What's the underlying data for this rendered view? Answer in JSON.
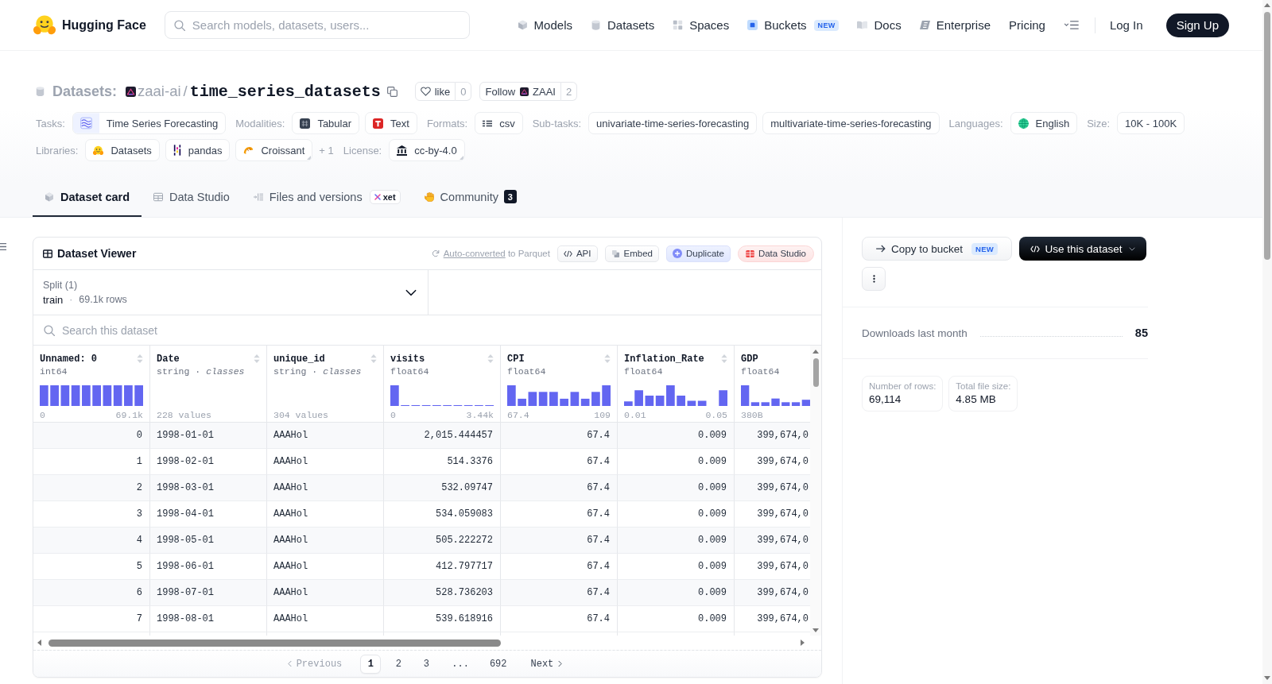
{
  "header": {
    "logo": "Hugging Face",
    "search": {
      "placeholder": "Search models, datasets, users..."
    },
    "nav": [
      {
        "label": "Models"
      },
      {
        "label": "Datasets"
      },
      {
        "label": "Spaces"
      },
      {
        "label": "Buckets",
        "badge": "NEW"
      },
      {
        "label": "Docs"
      },
      {
        "label": "Enterprise"
      },
      {
        "label": "Pricing"
      }
    ],
    "login": "Log In",
    "signup": "Sign Up"
  },
  "repo": {
    "type": "Datasets:",
    "owner": "zaai-ai",
    "separator": "/",
    "name": "time_series_datasets",
    "like": {
      "label": "like",
      "count": "0"
    },
    "follow": {
      "label": "Follow",
      "org": "ZAAI",
      "count": "2"
    }
  },
  "tag_rows": [
    {
      "groups": [
        {
          "label": "Tasks:",
          "tags": [
            {
              "text": "Time Series Forecasting"
            }
          ]
        },
        {
          "label": "Modalities:",
          "tags": [
            {
              "text": "Tabular"
            },
            {
              "text": "Text"
            }
          ]
        },
        {
          "label": "Formats:",
          "tags": [
            {
              "text": "csv"
            }
          ]
        },
        {
          "label": "Sub-tasks:",
          "tags": [
            {
              "text": "univariate-time-series-forecasting"
            },
            {
              "text": "multivariate-time-series-forecasting"
            }
          ]
        },
        {
          "label": "Languages:",
          "tags": [
            {
              "text": "English"
            }
          ]
        },
        {
          "label": "Size:",
          "tags": [
            {
              "text": "10K - 100K"
            }
          ]
        }
      ]
    },
    {
      "groups": [
        {
          "label": "Libraries:",
          "tags": [
            {
              "text": "Datasets",
              "dropdown": false
            },
            {
              "text": "pandas",
              "dropdown": false
            },
            {
              "text": "Croissant",
              "dropdown": true
            }
          ],
          "more": "+ 1"
        },
        {
          "label": "License:",
          "tags": [
            {
              "text": "cc-by-4.0",
              "dropdown": true
            }
          ]
        }
      ]
    }
  ],
  "tabs": [
    {
      "label": "Dataset card",
      "selected": true
    },
    {
      "label": "Data Studio",
      "selected": false
    },
    {
      "label": "Files and versions",
      "selected": false,
      "badge": "xet"
    },
    {
      "label": "Community",
      "selected": false,
      "count": "3"
    }
  ],
  "viewer": {
    "title": "Dataset Viewer",
    "conversion": {
      "link": "Auto-converted",
      "text": "to Parquet"
    },
    "actions": [
      {
        "label": "API"
      },
      {
        "label": "Embed"
      },
      {
        "label": "Duplicate"
      },
      {
        "label": "Data Studio"
      }
    ],
    "split": {
      "label": "Split (1)",
      "value": "train",
      "separator": "·",
      "rows": "69.1k rows"
    },
    "search": {
      "placeholder": "Search this dataset"
    },
    "columns": [
      {
        "name": "Unnamed: 0",
        "type": "int64",
        "kind": "numeric",
        "min": "0",
        "max": "69.1k"
      },
      {
        "name": "Date",
        "type": "string · *classes*",
        "kind": "classes",
        "count": "228 values"
      },
      {
        "name": "unique_id",
        "type": "string · *classes*",
        "kind": "classes",
        "count": "304 values"
      },
      {
        "name": "visits",
        "type": "float64",
        "kind": "numeric",
        "min": "0",
        "max": "3.44k"
      },
      {
        "name": "CPI",
        "type": "float64",
        "kind": "numeric",
        "min": "67.4",
        "max": "109"
      },
      {
        "name": "Inflation_Rate",
        "type": "float64",
        "kind": "numeric",
        "min": "0.01",
        "max": "0.05"
      },
      {
        "name": "GDP",
        "type": "float64",
        "kind": "numeric",
        "min": "380B"
      }
    ],
    "rows": [
      [
        "0",
        "1998-01-01",
        "AAAHol",
        "2,015.444457",
        "67.4",
        "0.009",
        "399,674,0"
      ],
      [
        "1",
        "1998-02-01",
        "AAAHol",
        "514.3376",
        "67.4",
        "0.009",
        "399,674,0"
      ],
      [
        "2",
        "1998-03-01",
        "AAAHol",
        "532.09747",
        "67.4",
        "0.009",
        "399,674,0"
      ],
      [
        "3",
        "1998-04-01",
        "AAAHol",
        "534.059083",
        "67.4",
        "0.009",
        "399,674,0"
      ],
      [
        "4",
        "1998-05-01",
        "AAAHol",
        "505.222272",
        "67.4",
        "0.009",
        "399,674,0"
      ],
      [
        "5",
        "1998-06-01",
        "AAAHol",
        "412.797717",
        "67.4",
        "0.009",
        "399,674,0"
      ],
      [
        "6",
        "1998-07-01",
        "AAAHol",
        "528.736203",
        "67.4",
        "0.009",
        "399,674,0"
      ],
      [
        "7",
        "1998-08-01",
        "AAAHol",
        "539.618916",
        "67.4",
        "0.009",
        "399,674,0"
      ]
    ],
    "pagination": {
      "previous": {
        "label": "Previous",
        "disabled": true
      },
      "pages": [
        {
          "label": "1",
          "kind": "page",
          "selected": true
        },
        {
          "label": "2",
          "kind": "page",
          "selected": false
        },
        {
          "label": "3",
          "kind": "page",
          "selected": false
        },
        {
          "label": "...",
          "kind": "ellipsis",
          "selected": false
        },
        {
          "label": "692",
          "kind": "page",
          "selected": false
        }
      ],
      "next": {
        "label": "Next",
        "disabled": false
      }
    }
  },
  "sidebar": {
    "copy": {
      "label": "Copy to bucket",
      "badge": "NEW"
    },
    "use": {
      "label": "Use this dataset"
    },
    "downloads": {
      "label": "Downloads last month",
      "value": "85"
    },
    "stats": [
      {
        "label": "Number of rows:",
        "value": "69,114"
      },
      {
        "label": "Total file size:",
        "value": "4.85 MB"
      }
    ]
  }
}
